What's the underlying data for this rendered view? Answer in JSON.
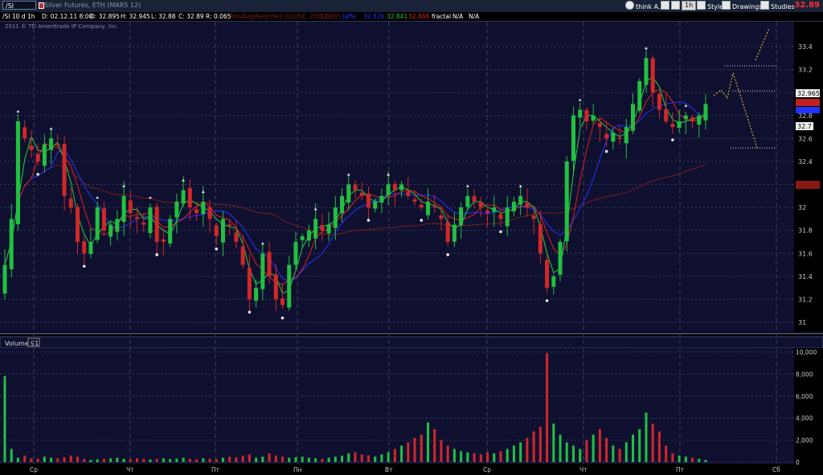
{
  "toolbar": {
    "symbol": "/SI",
    "instrument": "Silver Futures, ETH (MAR5 12)",
    "think_label": "think A.I.",
    "interval": "1h",
    "style_label": "Style",
    "drawings_label": "Drawings",
    "studies_label": "Studies",
    "last_price": "32.89"
  },
  "infobar": {
    "symbol_period": "/SI 10 d 1h",
    "date": "D: 02.12.11 8:00",
    "open": "O: 32.895",
    "high": "H: 32.945",
    "low": "L: 32.88",
    "close": "C: 32.89",
    "range": "R: 0.065",
    "study1": "MovAvgWeighted (CLOSE, 200, 0)",
    "study1_val": "32.385",
    "study2": "Jaffe",
    "study2_val": "32.826",
    "study3_val": "32.841",
    "study4_val": "32.866",
    "fractal": "fractal",
    "na1": "N/A",
    "na2": "N/A"
  },
  "copyright": "2011 © TD Ameritrade IP Company, Inc.",
  "volume_label": "Volume",
  "volume_value": "91",
  "price_tags": {
    "last": "32.965",
    "low_tag": "32.7"
  },
  "colors": {
    "background": "#0f1030",
    "grid": "#3a3f5a",
    "up": "#22c040",
    "down": "#d02828",
    "ma_green": "#1ed23c",
    "ma_red": "#e02020",
    "ma_blue": "#2233ff",
    "ma_long": "#7a1e1e",
    "projection": "#e8d040"
  },
  "chart_data": {
    "type": "candlestick",
    "y_ticks": [
      "33.4",
      "33.2",
      "33",
      "32.8",
      "32.6",
      "32.4",
      "32.2",
      "32",
      "31.8",
      "31.6",
      "31.4",
      "31.2",
      "31"
    ],
    "y_range": [
      30.95,
      33.55
    ],
    "volume_ticks": [
      "10,000",
      "8,000",
      "6,000",
      "4,000",
      "2,000",
      "0"
    ],
    "volume_range": [
      0,
      10000
    ],
    "x_labels": [
      "Ср",
      "Чт",
      "Пт",
      "Пн",
      "Вт",
      "Ср",
      "Чт",
      "Пт",
      "Сб"
    ],
    "series": [
      {
        "name": "close",
        "values": [
          31.5,
          31.9,
          32.75,
          32.6,
          32.5,
          32.4,
          32.55,
          32.6,
          32.55,
          32.1,
          32.0,
          31.7,
          31.6,
          31.7,
          32.0,
          31.8,
          31.85,
          31.9,
          32.1,
          31.95,
          31.9,
          31.85,
          32.0,
          31.7,
          31.7,
          31.9,
          32.05,
          32.15,
          32.0,
          31.95,
          32.05,
          31.9,
          31.75,
          31.9,
          31.85,
          31.7,
          31.5,
          31.2,
          31.3,
          31.6,
          31.4,
          31.2,
          31.15,
          31.5,
          31.7,
          31.75,
          31.8,
          31.9,
          31.8,
          31.85,
          32.0,
          32.1,
          32.2,
          32.15,
          32.1,
          32.0,
          32.05,
          32.1,
          32.2,
          32.15,
          32.2,
          32.1,
          32.05,
          32.0,
          32.05,
          32.0,
          31.9,
          31.7,
          31.85,
          32.0,
          32.1,
          32.05,
          32.0,
          31.95,
          32.0,
          31.9,
          32.0,
          32.05,
          32.1,
          32.0,
          31.9,
          31.6,
          31.3,
          31.4,
          31.7,
          32.4,
          32.8,
          32.85,
          32.75,
          32.8,
          32.7,
          32.6,
          32.65,
          32.6,
          32.7,
          32.9,
          33.1,
          33.3,
          33.0,
          32.85,
          32.75,
          32.7,
          32.75,
          32.8,
          32.75,
          32.8,
          32.9
        ]
      },
      {
        "name": "volume",
        "values": [
          7800,
          1200,
          400,
          600,
          350,
          300,
          500,
          400,
          350,
          450,
          600,
          500,
          300,
          200,
          250,
          300,
          350,
          400,
          300,
          280,
          350,
          300,
          250,
          300,
          350,
          280,
          320,
          400,
          300,
          250,
          350,
          300,
          280,
          400,
          500,
          450,
          600,
          700,
          400,
          500,
          800,
          600,
          500,
          400,
          450,
          500,
          400,
          350,
          300,
          400,
          500,
          600,
          800,
          900,
          700,
          600,
          500,
          700,
          900,
          1200,
          1500,
          1800,
          2200,
          2500,
          3600,
          3000,
          2000,
          1500,
          1200,
          1000,
          900,
          800,
          700,
          900,
          800,
          1000,
          1200,
          1500,
          1800,
          2200,
          2800,
          3200,
          9900,
          3500,
          2500,
          1800,
          1500,
          1200,
          2000,
          2500,
          3000,
          2200,
          1500,
          1200,
          1800,
          2500,
          3000,
          4500,
          3500,
          2800,
          1500,
          800,
          600,
          500,
          400,
          300,
          200
        ]
      }
    ]
  }
}
